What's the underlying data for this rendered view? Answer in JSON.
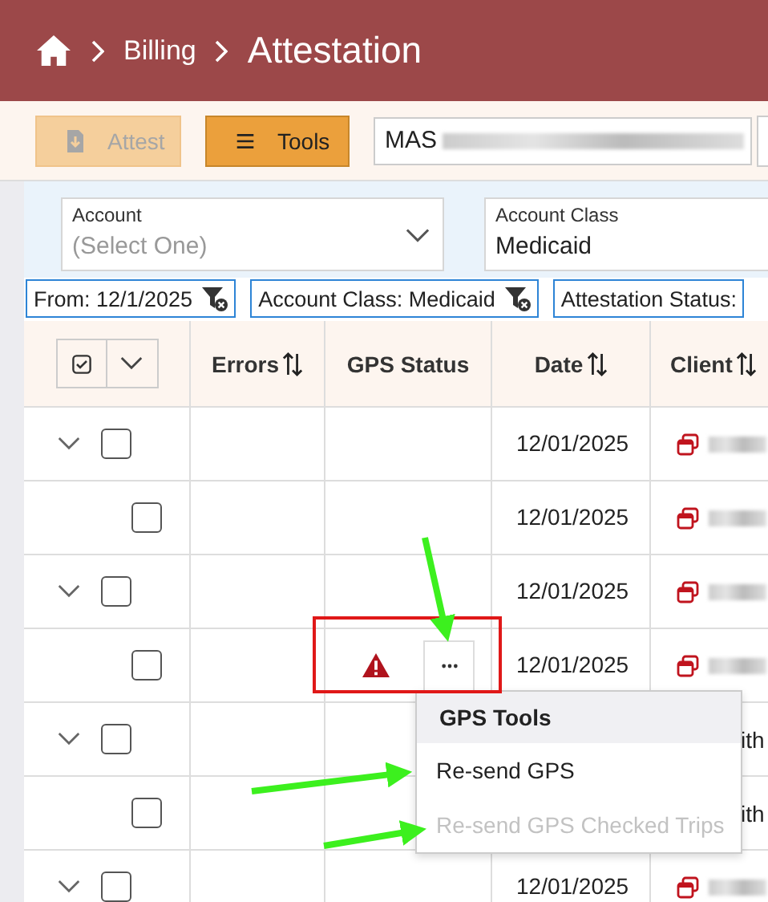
{
  "breadcrumb": [
    {
      "label": "Billing",
      "current": false
    },
    {
      "label": "Attestation",
      "current": true
    }
  ],
  "toolbar": {
    "buttons": [
      {
        "label": "Attest",
        "disabled": true,
        "kind": "attest"
      },
      {
        "label": "Tools",
        "disabled": false,
        "kind": "tools"
      }
    ],
    "search": {
      "value": "MAS"
    }
  },
  "filters": [
    {
      "label": "Account",
      "placeholder": "(Select One)",
      "kind": "select"
    },
    {
      "label": "Account Class",
      "value": "Medicaid",
      "kind": "text"
    }
  ],
  "chips": [
    {
      "label": "From: 12/1/2025",
      "removable": true
    },
    {
      "label": "Account Class: Medicaid",
      "removable": true
    },
    {
      "label": "Attestation Status:",
      "removable": false
    }
  ],
  "table": {
    "columns": [
      {
        "label": "Errors",
        "sortable": true
      },
      {
        "label": "GPS Status",
        "sortable": false
      },
      {
        "label": "Date",
        "sortable": true
      },
      {
        "label": "Client",
        "sortable": true
      }
    ],
    "rows": [
      {
        "kind": "parent",
        "checked": false,
        "date": "12/01/2025",
        "gps_error": false
      },
      {
        "kind": "child",
        "checked": false,
        "date": "12/01/2025",
        "gps_error": false
      },
      {
        "kind": "parent",
        "checked": false,
        "date": "12/01/2025",
        "gps_error": false
      },
      {
        "kind": "child",
        "checked": false,
        "date": "12/01/2025",
        "gps_error": true
      },
      {
        "kind": "parent",
        "checked": false,
        "client": "ith",
        "gps_error": false
      },
      {
        "kind": "child",
        "checked": false,
        "client": "ith",
        "gps_error": false
      },
      {
        "kind": "parent",
        "checked": false,
        "date": "12/01/2025",
        "gps_error": false
      }
    ]
  },
  "menu": {
    "title": "GPS Tools",
    "items": [
      {
        "label": "Re-send GPS",
        "disabled": false
      },
      {
        "label": "Re-send GPS Checked Trips",
        "disabled": true
      }
    ]
  },
  "annotations": [
    {
      "kind": "box"
    },
    {
      "kind": "arrow"
    },
    {
      "kind": "arrow"
    },
    {
      "kind": "arrow"
    }
  ]
}
